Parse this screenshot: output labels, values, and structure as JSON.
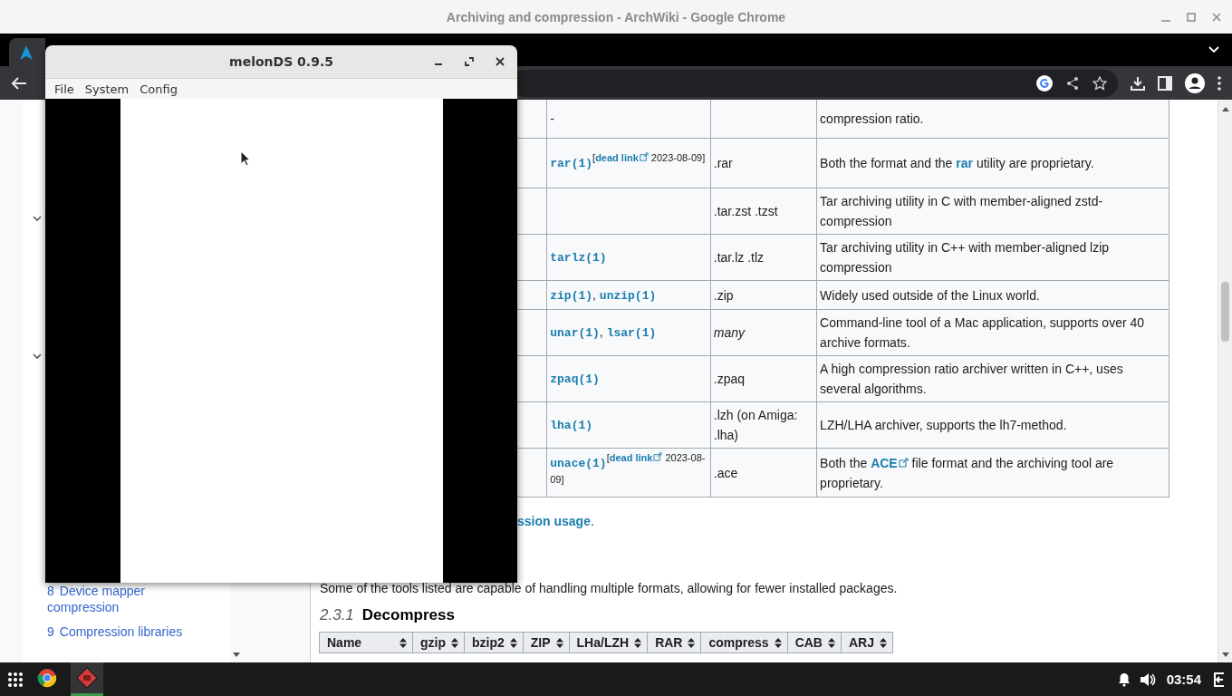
{
  "window": {
    "title": "Archiving and compression - ArchWiki - Google Chrome"
  },
  "page": {
    "toc": [
      {
        "number": "8",
        "label": "Device mapper compression"
      },
      {
        "number": "9",
        "label": "Compression libraries"
      }
    ],
    "table": {
      "rows": [
        {
          "command": [
            {
              "kind": "text",
              "text": "-"
            }
          ],
          "description": [
            {
              "kind": "text",
              "text": "compression ratio."
            }
          ]
        },
        {
          "command": [
            {
              "kind": "code",
              "text": "rar(1)"
            },
            {
              "kind": "note",
              "open": "[",
              "link": "dead link",
              "close": " 2023-08-09]"
            }
          ],
          "extension": {
            "text": ".rar",
            "italic": false
          },
          "description": [
            {
              "kind": "text",
              "text": "Both the format and the "
            },
            {
              "kind": "link",
              "text": "rar"
            },
            {
              "kind": "text",
              "text": " utility are proprietary."
            }
          ]
        },
        {
          "extension": {
            "text": ".tar.zst .tzst",
            "italic": false
          },
          "description": [
            {
              "kind": "text",
              "text": "Tar archiving utility in C with member-aligned zstd-compression"
            }
          ]
        },
        {
          "command": [
            {
              "kind": "code",
              "text": "tarlz(1)"
            }
          ],
          "extension": {
            "text": ".tar.lz .tlz",
            "italic": false
          },
          "description": [
            {
              "kind": "text",
              "text": "Tar archiving utility in C++ with member-aligned lzip compression"
            }
          ]
        },
        {
          "command": [
            {
              "kind": "code",
              "text": "zip(1)"
            },
            {
              "kind": "text",
              "text": ", "
            },
            {
              "kind": "code",
              "text": "unzip(1)"
            }
          ],
          "extension": {
            "text": ".zip",
            "italic": false
          },
          "description": [
            {
              "kind": "text",
              "text": "Widely used outside of the Linux world."
            }
          ]
        },
        {
          "command": [
            {
              "kind": "code",
              "text": "unar(1)"
            },
            {
              "kind": "text",
              "text": ", "
            },
            {
              "kind": "code",
              "text": "lsar(1)"
            }
          ],
          "extension": {
            "text": "many",
            "italic": true
          },
          "description": [
            {
              "kind": "text",
              "text": "Command-line tool of a Mac application, supports over 40 archive formats."
            }
          ]
        },
        {
          "command": [
            {
              "kind": "code",
              "text": "zpaq(1)"
            }
          ],
          "extension": {
            "text": ".zpaq",
            "italic": false
          },
          "description": [
            {
              "kind": "text",
              "text": "A high compression ratio archiver written in C++, uses several algorithms."
            }
          ]
        },
        {
          "command": [
            {
              "kind": "code",
              "text": "lha(1)"
            }
          ],
          "extension": {
            "text": ".lzh (on Amiga: .lha)",
            "italic": false
          },
          "description": [
            {
              "kind": "text",
              "text": "LZH/LHA archiver, supports the lh7-method."
            }
          ]
        },
        {
          "command": [
            {
              "kind": "code",
              "text": "unace(1)"
            },
            {
              "kind": "note",
              "open": "[",
              "link": "dead link",
              "close": " 2023-08-09]"
            }
          ],
          "extension": {
            "text": ".ace",
            "italic": false
          },
          "description": [
            {
              "kind": "text",
              "text": "Both the "
            },
            {
              "kind": "ext_link",
              "text": "ACE"
            },
            {
              "kind": "text",
              "text": " file format and the archiving tool are proprietary."
            }
          ]
        }
      ]
    },
    "note": [
      {
        "kind": "link",
        "text": "ssion usage"
      },
      {
        "kind": "text",
        "text": "."
      }
    ],
    "intro": "Some of the tools listed are capable of handling multiple formats, allowing for fewer installed packages.",
    "section": {
      "number": "2.3.1",
      "title": "Decompress"
    },
    "formats_table": {
      "columns": [
        "Name",
        "gzip",
        "bzip2",
        "ZIP",
        "LHa/LZH",
        "RAR",
        "compress",
        "CAB",
        "ARJ"
      ]
    }
  },
  "melonds": {
    "title": "melonDS 0.9.5",
    "menu": [
      "File",
      "System",
      "Config"
    ]
  },
  "taskbar": {
    "apps": [
      {
        "kind": "browser",
        "selected": false
      },
      {
        "kind": "emulator",
        "selected": true
      }
    ],
    "clock": "03:54"
  }
}
